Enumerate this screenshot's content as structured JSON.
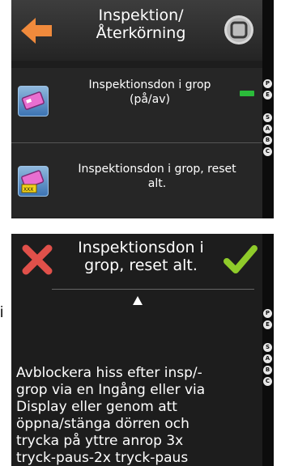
{
  "screen1": {
    "header": {
      "title_line1": "Inspektion/",
      "title_line2": "Återkörning",
      "back_icon": "arrow-left-icon",
      "home_icon": "stop-square-icon",
      "accent_color": "#f08a3c"
    },
    "items": [
      {
        "line1": "Inspektionsdon i grop",
        "line2": "(på/av)",
        "icon": "inspection-device-icon",
        "toggle_state": "on"
      },
      {
        "line1": "Inspektionsdon i grop, reset",
        "line2": "alt.",
        "icon": "inspection-device-reset-icon"
      }
    ],
    "side_icons": [
      "P",
      "E",
      "S",
      "A",
      "B",
      "C"
    ]
  },
  "screen2": {
    "title_line1": "Inspektionsdon i",
    "title_line2": "grop, reset alt.",
    "cancel_icon": "cross-icon",
    "confirm_icon": "checkmark-icon",
    "cancel_color": "#e0504a",
    "confirm_color": "#8fcb2a",
    "text_lines": [
      "Avblockera hiss efter insp/-",
      "grop via en Ingång eller via",
      "Display eller genom att",
      "öppna/stänga dörren och",
      "trycka på yttre anrop 3x",
      "tryck-paus-2x tryck-paus"
    ],
    "side_icons": [
      "P",
      "E",
      "S",
      "A",
      "B",
      "C"
    ]
  },
  "page_letter": "i"
}
